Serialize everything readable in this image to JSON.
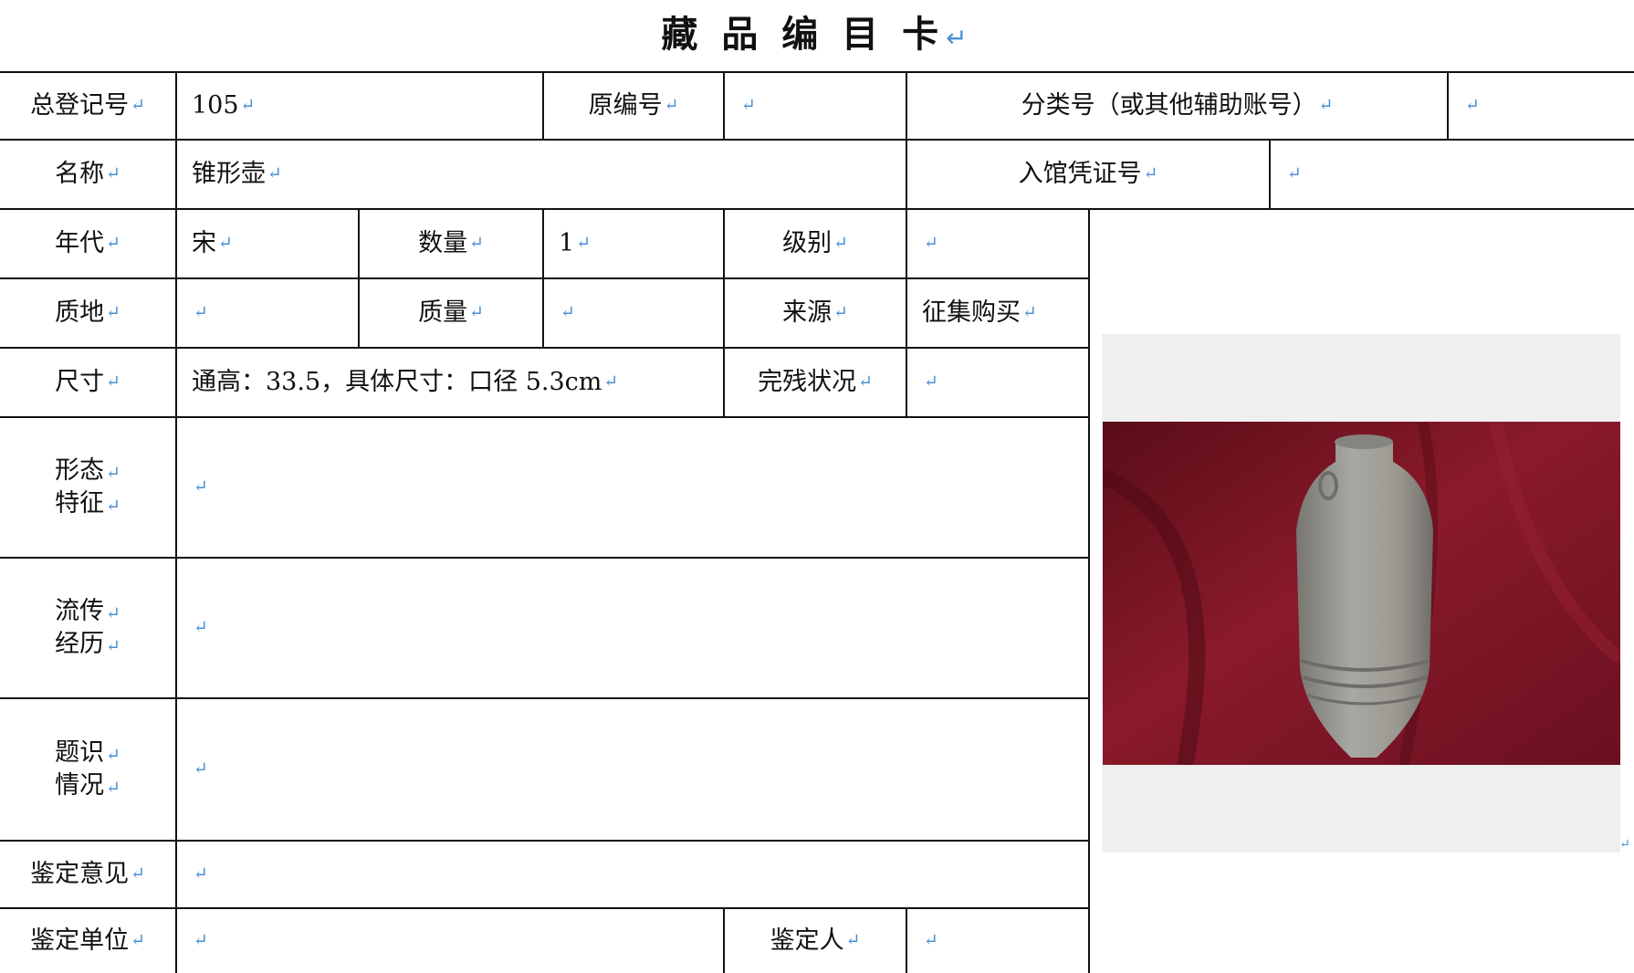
{
  "title": "藏 品 编 目 卡",
  "paragraph_mark": "↵",
  "fields": {
    "registration_no": {
      "label": "总登记号",
      "value": "105"
    },
    "original_no": {
      "label": "原编号",
      "value": ""
    },
    "classification_no": {
      "label": "分类号（或其他辅助账号）",
      "value": ""
    },
    "name": {
      "label": "名称",
      "value": "锥形壶"
    },
    "accession_voucher_no": {
      "label": "入馆凭证号",
      "value": ""
    },
    "era": {
      "label": "年代",
      "value": "宋"
    },
    "quantity": {
      "label": "数量",
      "value": "1"
    },
    "grade": {
      "label": "级别",
      "value": ""
    },
    "material": {
      "label": "质地",
      "value": ""
    },
    "weight": {
      "label": "质量",
      "value": ""
    },
    "source": {
      "label": "来源",
      "value": "征集购买"
    },
    "dimensions": {
      "label": "尺寸",
      "value": "通高：33.5，具体尺寸：口径 5.3cm"
    },
    "condition": {
      "label": "完残状况",
      "value": ""
    },
    "form_features": {
      "label_line1": "形态",
      "label_line2": "特征",
      "value": ""
    },
    "provenance": {
      "label_line1": "流传",
      "label_line2": "经历",
      "value": ""
    },
    "inscriptions": {
      "label_line1": "题识",
      "label_line2": "情况",
      "value": ""
    },
    "appraisal_opinion": {
      "label": "鉴定意见",
      "value": ""
    },
    "appraisal_unit": {
      "label": "鉴定单位",
      "value": ""
    },
    "appraiser": {
      "label": "鉴定人",
      "value": ""
    }
  },
  "photo": {
    "backdrop_color": "#7a1522",
    "object_color": "#9a9a94"
  }
}
